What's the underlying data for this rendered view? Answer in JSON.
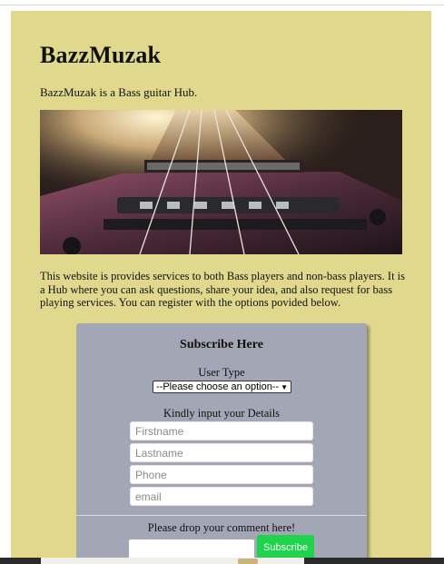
{
  "site": {
    "title": "BazzMuzak",
    "tagline": "BazzMuzak is a Bass guitar Hub.",
    "description": "This website is provides services to both Bass players and non-bass players. It is a Hub where you can ask questions, share your idea, and also request for bass playing services. You can register with the options povided below."
  },
  "subscribe": {
    "heading": "Subscribe Here",
    "user_type_label": "User Type",
    "user_type_selected": "--Please choose an option--",
    "details_label": "Kindly input your Details",
    "firstname_placeholder": "Firstname",
    "lastname_placeholder": "Lastname",
    "phone_placeholder": "Phone",
    "email_placeholder": "email",
    "comment_label": "Please drop your comment here!",
    "submit_label": "Subscribe"
  },
  "colors": {
    "page_background": "#e0d98d",
    "card_background": "#a3a6b4",
    "submit_button": "#1fd34c"
  }
}
